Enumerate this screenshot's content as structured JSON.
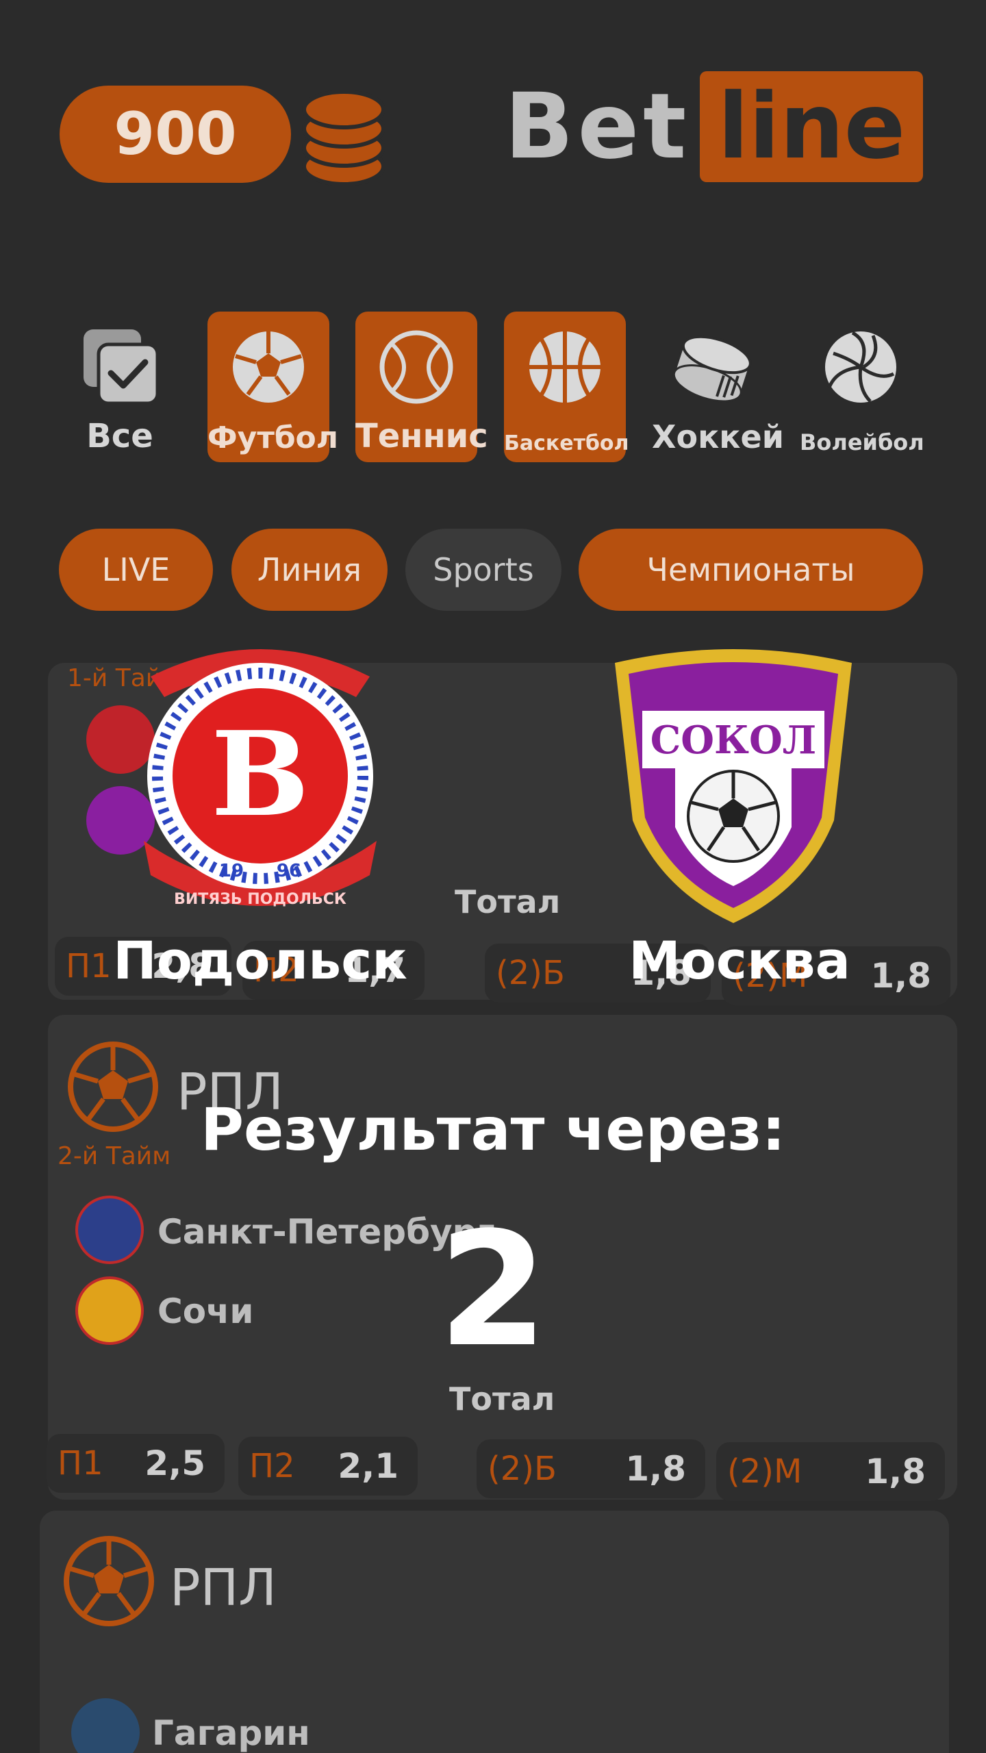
{
  "header": {
    "balance": "900",
    "logo_left": "Bet",
    "logo_right": "line"
  },
  "categories": [
    {
      "label": "Все",
      "icon": "checkbox-icon",
      "active": false
    },
    {
      "label": "Футбол",
      "icon": "soccer-ball-icon",
      "active": true
    },
    {
      "label": "Теннис",
      "icon": "tennis-ball-icon",
      "active": true
    },
    {
      "label": "Баскетбол",
      "icon": "basketball-icon",
      "active": true
    },
    {
      "label": "Хоккей",
      "icon": "hockey-puck-icon",
      "active": false
    },
    {
      "label": "Волейбол",
      "icon": "volleyball-icon",
      "active": false
    }
  ],
  "filters": [
    {
      "label": "LIVE",
      "active": true
    },
    {
      "label": "Линия",
      "active": true
    },
    {
      "label": "Sports",
      "active": false
    },
    {
      "label": "Чемпионаты",
      "active": true
    }
  ],
  "matches": [
    {
      "half": "1-й Тайм",
      "total_label": "Тотал",
      "odds": [
        {
          "key": "П1",
          "value": "2,8"
        },
        {
          "key": "П2",
          "value": "1,7"
        },
        {
          "key": "(2)Б",
          "value": "1,8"
        },
        {
          "key": "(2)М",
          "value": "1,8"
        }
      ]
    },
    {
      "league": "РПЛ",
      "half": "2-й Тайм",
      "team1": "Санкт-Петербург",
      "team2": "Сочи",
      "total_label": "Тотал",
      "odds": [
        {
          "key": "П1",
          "value": "2,5"
        },
        {
          "key": "П2",
          "value": "2,1"
        },
        {
          "key": "(2)Б",
          "value": "1,8"
        },
        {
          "key": "(2)М",
          "value": "1,8"
        }
      ]
    },
    {
      "league": "РПЛ",
      "team1": "Гагарин"
    }
  ],
  "overlay": {
    "home_team": "Подольск",
    "away_team": "Москва",
    "home_logo_banner": "ВИТЯЗЬ ПОДОЛЬСК",
    "home_logo_year_left": "19",
    "home_logo_year_right": "96",
    "away_logo_text": "СОКОЛ",
    "result_label": "Результат через:",
    "countdown": "2"
  },
  "colors": {
    "background": "#2b2b2b",
    "accent": "#b6500f",
    "card": "#363636",
    "odd_box": "#2d2d2d"
  }
}
